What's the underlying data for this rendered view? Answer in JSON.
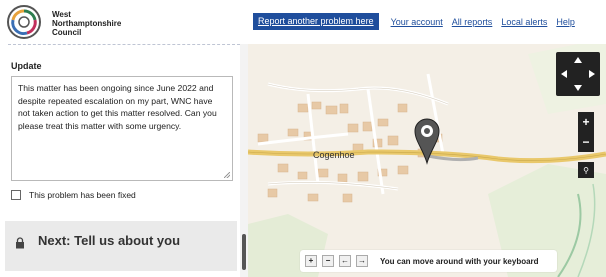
{
  "header": {
    "council_line1": "West",
    "council_line2": "Northamptonshire",
    "council_line3": "Council",
    "nav": [
      {
        "label": "Report another problem here",
        "primary": true
      },
      {
        "label": "Your account"
      },
      {
        "label": "All reports"
      },
      {
        "label": "Local alerts"
      },
      {
        "label": "Help"
      }
    ]
  },
  "sidebar": {
    "update_label": "Update",
    "update_text": "This matter has been ongoing since June 2022 and despite repeated escalation on my part, WNC have not taken action to get this matter resolved.  Can you please treat this matter with some urgency.",
    "fixed_checkbox_label": "This problem has been fixed",
    "next_heading": "Next: Tell us about you"
  },
  "map": {
    "town_label": "Cogenhoe",
    "keyboard_hint": "You can move around with your keyboard",
    "keyboard_buttons": [
      "+",
      "−",
      "←",
      "→"
    ],
    "zoom_in": "+",
    "zoom_out": "−"
  },
  "colors": {
    "brand": "#1f4e9c",
    "map_bg": "#f5f1e9",
    "control_bg": "#222222"
  }
}
